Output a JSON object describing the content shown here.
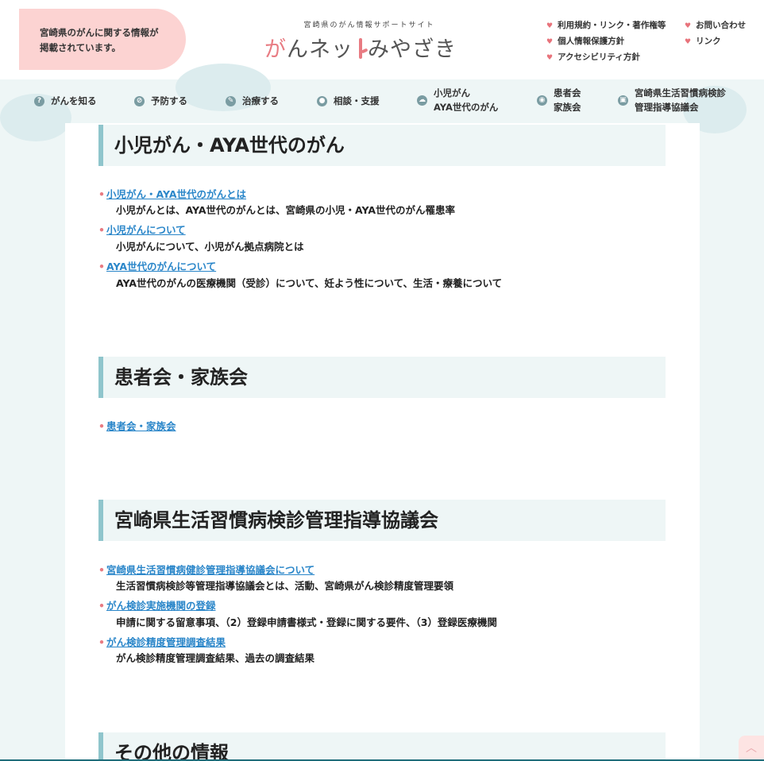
{
  "header": {
    "notice_line1": "宮崎県のがんに関する情報が",
    "notice_line2": "掲載されています。",
    "site_subtitle": "宮崎県のがん情報サポートサイト",
    "logo_part1": "が",
    "logo_part2": "んネッ",
    "logo_part3": "みやざき",
    "util_links": [
      {
        "label": "利用規約・リンク・著作権等"
      },
      {
        "label": "個人情報保護方針"
      },
      {
        "label": "アクセシビリティ方針"
      },
      {
        "label": "お問い合わせ"
      },
      {
        "label": "リンク"
      }
    ]
  },
  "nav": {
    "items": [
      {
        "line1": "がんを知る",
        "line2": "",
        "icon": "question-icon"
      },
      {
        "line1": "予防する",
        "line2": "",
        "icon": "shield-icon"
      },
      {
        "line1": "治療する",
        "line2": "",
        "icon": "pencil-icon"
      },
      {
        "line1": "相談・支援",
        "line2": "",
        "icon": "person-icon"
      },
      {
        "line1": "小児がん",
        "line2": "AYA世代のがん",
        "icon": "cloud-icon"
      },
      {
        "line1": "患者会",
        "line2": "家族会",
        "icon": "circle-icon"
      },
      {
        "line1": "宮崎県生活習慣病検診",
        "line2": "管理指導協議会",
        "icon": "box-icon"
      }
    ]
  },
  "sections": [
    {
      "title": "小児がん・AYA世代のがん",
      "items": [
        {
          "link": "小児がん・AYA世代のがんとは",
          "desc": "小児がんとは、AYA世代のがんとは、宮崎県の小児・AYA世代のがん罹患率"
        },
        {
          "link": "小児がんについて",
          "desc": "小児がんについて、小児がん拠点病院とは"
        },
        {
          "link": "AYA世代のがんについて",
          "desc": "AYA世代のがんの医療機関（受診）について、妊よう性について、生活・療養について"
        }
      ]
    },
    {
      "title": "患者会・家族会",
      "items": [
        {
          "link": "患者会・家族会",
          "desc": ""
        }
      ]
    },
    {
      "title": "宮崎県生活習慣病検診管理指導協議会",
      "items": [
        {
          "link": "宮崎県生活習慣病健診管理指導協議会について",
          "desc": "生活習慣病検診等管理指導協議会とは、活動、宮崎県がん検診精度管理要領"
        },
        {
          "link": "がん検診実施機関の登録",
          "desc": "申請に関する留意事項、（2）登録申請書様式・登録に関する要件、（3）登録医療機関"
        },
        {
          "link": "がん検診精度管理調査結果",
          "desc": "がん検診精度管理調査結果、過去の調査結果"
        }
      ]
    },
    {
      "title": "その他の情報",
      "items": []
    }
  ],
  "colors": {
    "accent_pink": "#e87b82",
    "link_blue": "#2a86c9",
    "section_border": "#8fc5cc",
    "section_bg": "#eef6f6"
  }
}
